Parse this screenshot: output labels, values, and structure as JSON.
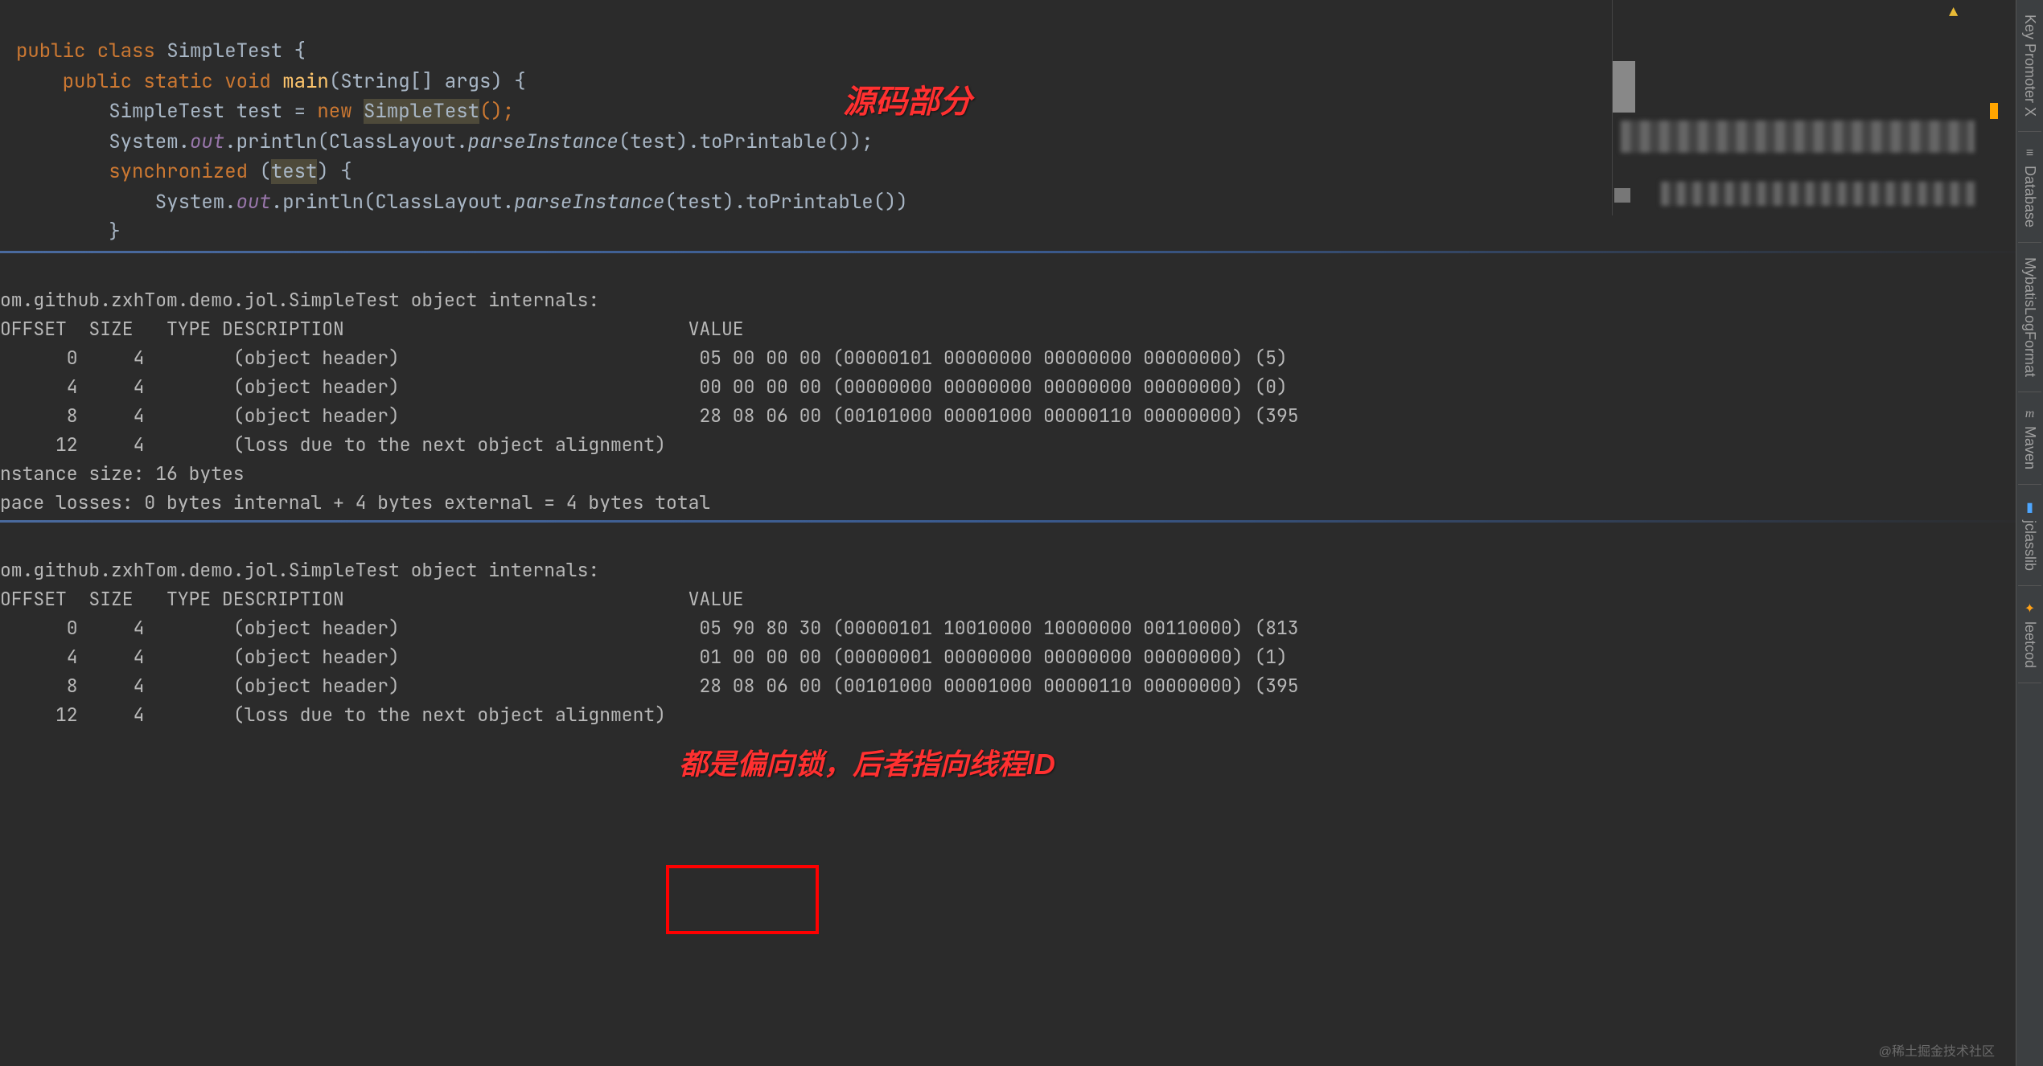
{
  "code": {
    "l1a": "public class ",
    "l1b": "SimpleTest ",
    "l1c": "{",
    "l2a": "    public static void ",
    "l2b": "main",
    "l2c": "(String[] args) {",
    "l3a": "        SimpleTest test = ",
    "l3b": "new ",
    "l3c": "SimpleTest",
    "l3d": "();",
    "l4a": "        System.",
    "l4b": "out",
    "l4c": ".println(ClassLayout.",
    "l4d": "parseInstance",
    "l4e": "(test).toPrintable());",
    "l5a": "        ",
    "l5b": "synchronized ",
    "l5c": "(",
    "l5d": "test",
    "l5e": ") {",
    "l6a": "            System.",
    "l6b": "out",
    "l6c": ".println(ClassLayout.",
    "l6d": "parseInstance",
    "l6e": "(test).toPrintable())",
    "l7": "        }"
  },
  "annotations": {
    "source_part": "源码部分",
    "biased_lock": "都是偏向锁，后者指向线程ID"
  },
  "console1": {
    "title": "om.github.zxhTom.demo.jol.SimpleTest object internals:",
    "header": "OFFSET  SIZE   TYPE DESCRIPTION                               VALUE",
    "r1": "      0     4        (object header)                           05 00 00 00 (00000101 00000000 00000000 00000000) (5)",
    "r2": "      4     4        (object header)                           00 00 00 00 (00000000 00000000 00000000 00000000) (0)",
    "r3": "      8     4        (object header)                           28 08 06 00 (00101000 00001000 00000110 00000000) (395",
    "r4": "     12     4        (loss due to the next object alignment)",
    "inst": "nstance size: 16 bytes",
    "loss": "pace losses: 0 bytes internal + 4 bytes external = 4 bytes total"
  },
  "console2": {
    "title": "om.github.zxhTom.demo.jol.SimpleTest object internals:",
    "header": "OFFSET  SIZE   TYPE DESCRIPTION                               VALUE",
    "r1": "      0     4        (object header)                           05 90 80 30 (00000101 10010000 10000000 00110000) (813",
    "r2": "      4     4        (object header)                           01 00 00 00 (00000001 00000000 00000000 00000000) (1)",
    "r3": "      8     4        (object header)                           28 08 06 00 (00101000 00001000 00000110 00000000) (395",
    "r4": "     12     4        (loss due to the next object alignment)"
  },
  "right_tools": {
    "t1": "Key Promoter X",
    "t2": "Database",
    "t3": "MybatisLogFormat",
    "t4": "Maven",
    "t5": "jclasslib",
    "t6": "leetcod"
  },
  "watermark": "@稀土掘金技术社区"
}
